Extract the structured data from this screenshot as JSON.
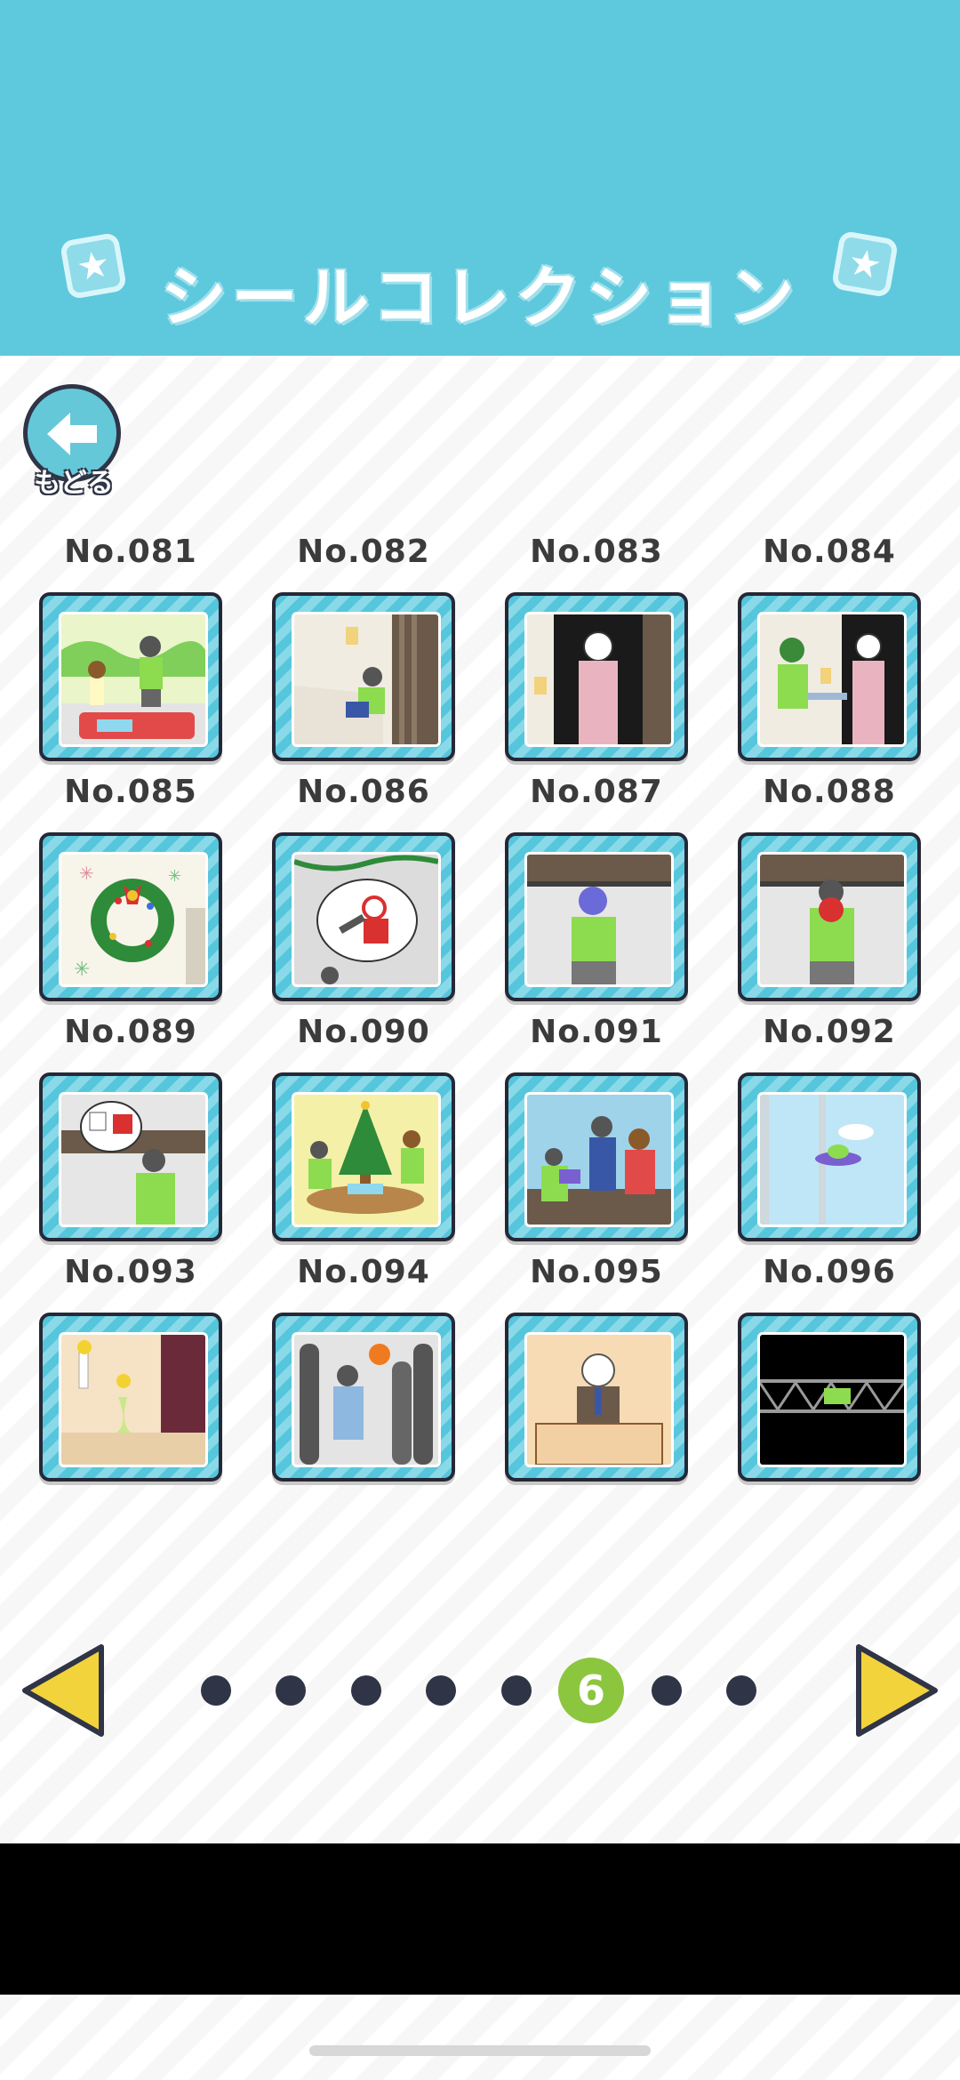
{
  "header": {
    "title": "シールコレクション"
  },
  "back": {
    "label": "もどる"
  },
  "stickers": [
    {
      "number": "No.081",
      "scene": "couple-walking-park"
    },
    {
      "number": "No.082",
      "scene": "boy-at-door"
    },
    {
      "number": "No.083",
      "scene": "woman-in-doorway"
    },
    {
      "number": "No.084",
      "scene": "delivery-at-door"
    },
    {
      "number": "No.085",
      "scene": "christmas-wreath"
    },
    {
      "number": "No.086",
      "scene": "santa-thought-bubble"
    },
    {
      "number": "No.087",
      "scene": "boy-worried"
    },
    {
      "number": "No.088",
      "scene": "boy-with-bouquet"
    },
    {
      "number": "No.089",
      "scene": "boy-thinking-gift"
    },
    {
      "number": "No.090",
      "scene": "christmas-party"
    },
    {
      "number": "No.091",
      "scene": "boys-laughing"
    },
    {
      "number": "No.092",
      "scene": "ufo-window"
    },
    {
      "number": "No.093",
      "scene": "flower-vase-room"
    },
    {
      "number": "No.094",
      "scene": "basketball-crowd"
    },
    {
      "number": "No.095",
      "scene": "old-man-desk"
    },
    {
      "number": "No.096",
      "scene": "dark-bridge"
    }
  ],
  "pagination": {
    "current": "6",
    "total": 8
  },
  "colors": {
    "header": "#5ec8dd",
    "active_dot": "#8cc63f",
    "dot": "#2f3446",
    "arrow": "#f3d33b"
  },
  "icons": {
    "back": "left-arrow-icon",
    "prev": "triangle-left-icon",
    "next": "triangle-right-icon"
  }
}
